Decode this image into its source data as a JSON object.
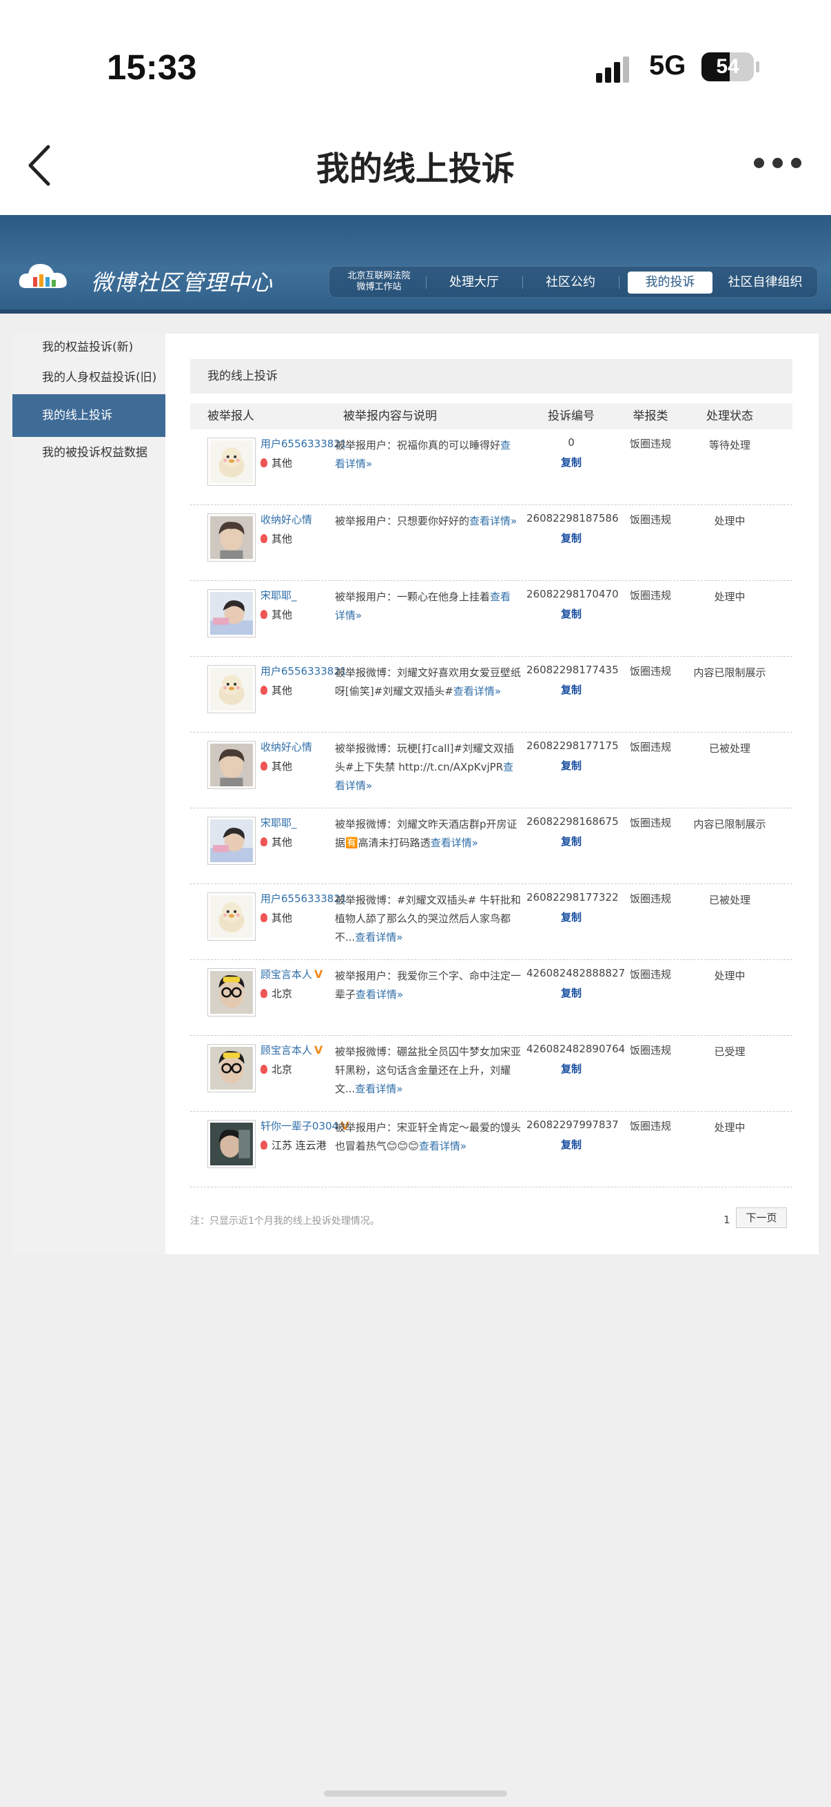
{
  "status_bar": {
    "time": "15:33",
    "network": "5G",
    "battery": "54",
    "battery_level": 0.54
  },
  "nav": {
    "title": "我的线上投诉"
  },
  "banner": {
    "logo_text": "微博社区管理中心",
    "court_label_1": "北京互联网法院",
    "court_label_2": "微博工作站",
    "items": [
      "处理大厅",
      "社区公约",
      "我的投诉",
      "社区自律组织"
    ],
    "active_item": "我的投诉"
  },
  "sidebar": {
    "items": [
      "我的权益投诉(新)",
      "我的人身权益投诉(旧)",
      "我的线上投诉",
      "我的被投诉权益数据"
    ],
    "active": "我的线上投诉"
  },
  "panel": {
    "title": "我的线上投诉"
  },
  "table": {
    "headers": [
      "被举报人",
      "被举报内容与说明",
      "投诉编号",
      "举报类",
      "处理状态"
    ],
    "copy_label": "复制",
    "rows": [
      {
        "user": "用户6556333821",
        "verified": false,
        "location": "其他",
        "desc": "被举报用户：祝福你真的可以睡得好",
        "more": "查看详情»",
        "id": "0",
        "type": "饭圈违规",
        "status": "等待处理",
        "avatar": "chick"
      },
      {
        "user": "收纳好心情",
        "verified": false,
        "location": "其他",
        "desc": "被举报用户：只想要你好好的",
        "more": "查看详情»",
        "id": "26082298187586",
        "type": "饭圈违规",
        "status": "处理中",
        "avatar": "person1"
      },
      {
        "user": "宋耶耶_",
        "verified": false,
        "location": "其他",
        "desc": "被举报用户：一颗心在他身上挂着",
        "more": "查看详情»",
        "id": "26082298170470",
        "type": "饭圈违规",
        "status": "处理中",
        "avatar": "person2"
      },
      {
        "user": "用户6556333821",
        "verified": false,
        "location": "其他",
        "desc": "被举报微博：刘耀文好喜欢用女爱豆壁纸呀[偷笑]#刘耀文双插头#",
        "more": "查看详情»",
        "id": "26082298177435",
        "type": "饭圈违规",
        "status": "内容已限制展示",
        "avatar": "chick"
      },
      {
        "user": "收纳好心情",
        "verified": false,
        "location": "其他",
        "desc": "被举报微博：玩梗[打call]#刘耀文双插头#上下失禁 http://t.cn/AXpKvjPR",
        "more": "查看详情»",
        "id": "26082298177175",
        "type": "饭圈违规",
        "status": "已被处理",
        "avatar": "person1"
      },
      {
        "user": "宋耶耶_",
        "verified": false,
        "location": "其他",
        "desc": "被举报微博：刘耀文昨天酒店群p开房证据🈶高清未打码路透",
        "more": "查看详情»",
        "id": "26082298168675",
        "type": "饭圈违规",
        "status": "内容已限制展示",
        "avatar": "person2"
      },
      {
        "user": "用户6556333821",
        "verified": false,
        "location": "其他",
        "desc": "被举报微博：#刘耀文双插头# 牛轩批和植物人舔了那么久的哭泣然后人家鸟都不...",
        "more": "查看详情»",
        "id": "26082298177322",
        "type": "饭圈违规",
        "status": "已被处理",
        "avatar": "chick"
      },
      {
        "user": "顾宝言本人",
        "verified": true,
        "location": "北京",
        "desc": "被举报用户：我爱你三个字、命中注定一辈子",
        "more": "查看详情»",
        "id": "426082482888827",
        "type": "饭圈违规",
        "status": "处理中",
        "avatar": "glasses"
      },
      {
        "user": "顾宝言本人",
        "verified": true,
        "location": "北京",
        "desc": "被举报微博：硼盆批全员囚牛梦女加宋亚轩黑粉，这句话含金量还在上升，刘耀文...",
        "more": "查看详情»",
        "id": "426082482890764",
        "type": "饭圈违规",
        "status": "已受理",
        "avatar": "glasses"
      },
      {
        "user": "轩你一辈子0304",
        "verified": true,
        "location": "江苏 连云港",
        "desc": "被举报用户：宋亚轩全肯定～最爱的馒头也冒着热气😊😊😊",
        "more": "查看详情»",
        "id": "26082297997837",
        "type": "饭圈违规",
        "status": "处理中",
        "avatar": "person3"
      }
    ]
  },
  "footer": {
    "note": "注：只显示近1个月我的线上投诉处理情况。",
    "page": "1",
    "next": "下一页"
  }
}
